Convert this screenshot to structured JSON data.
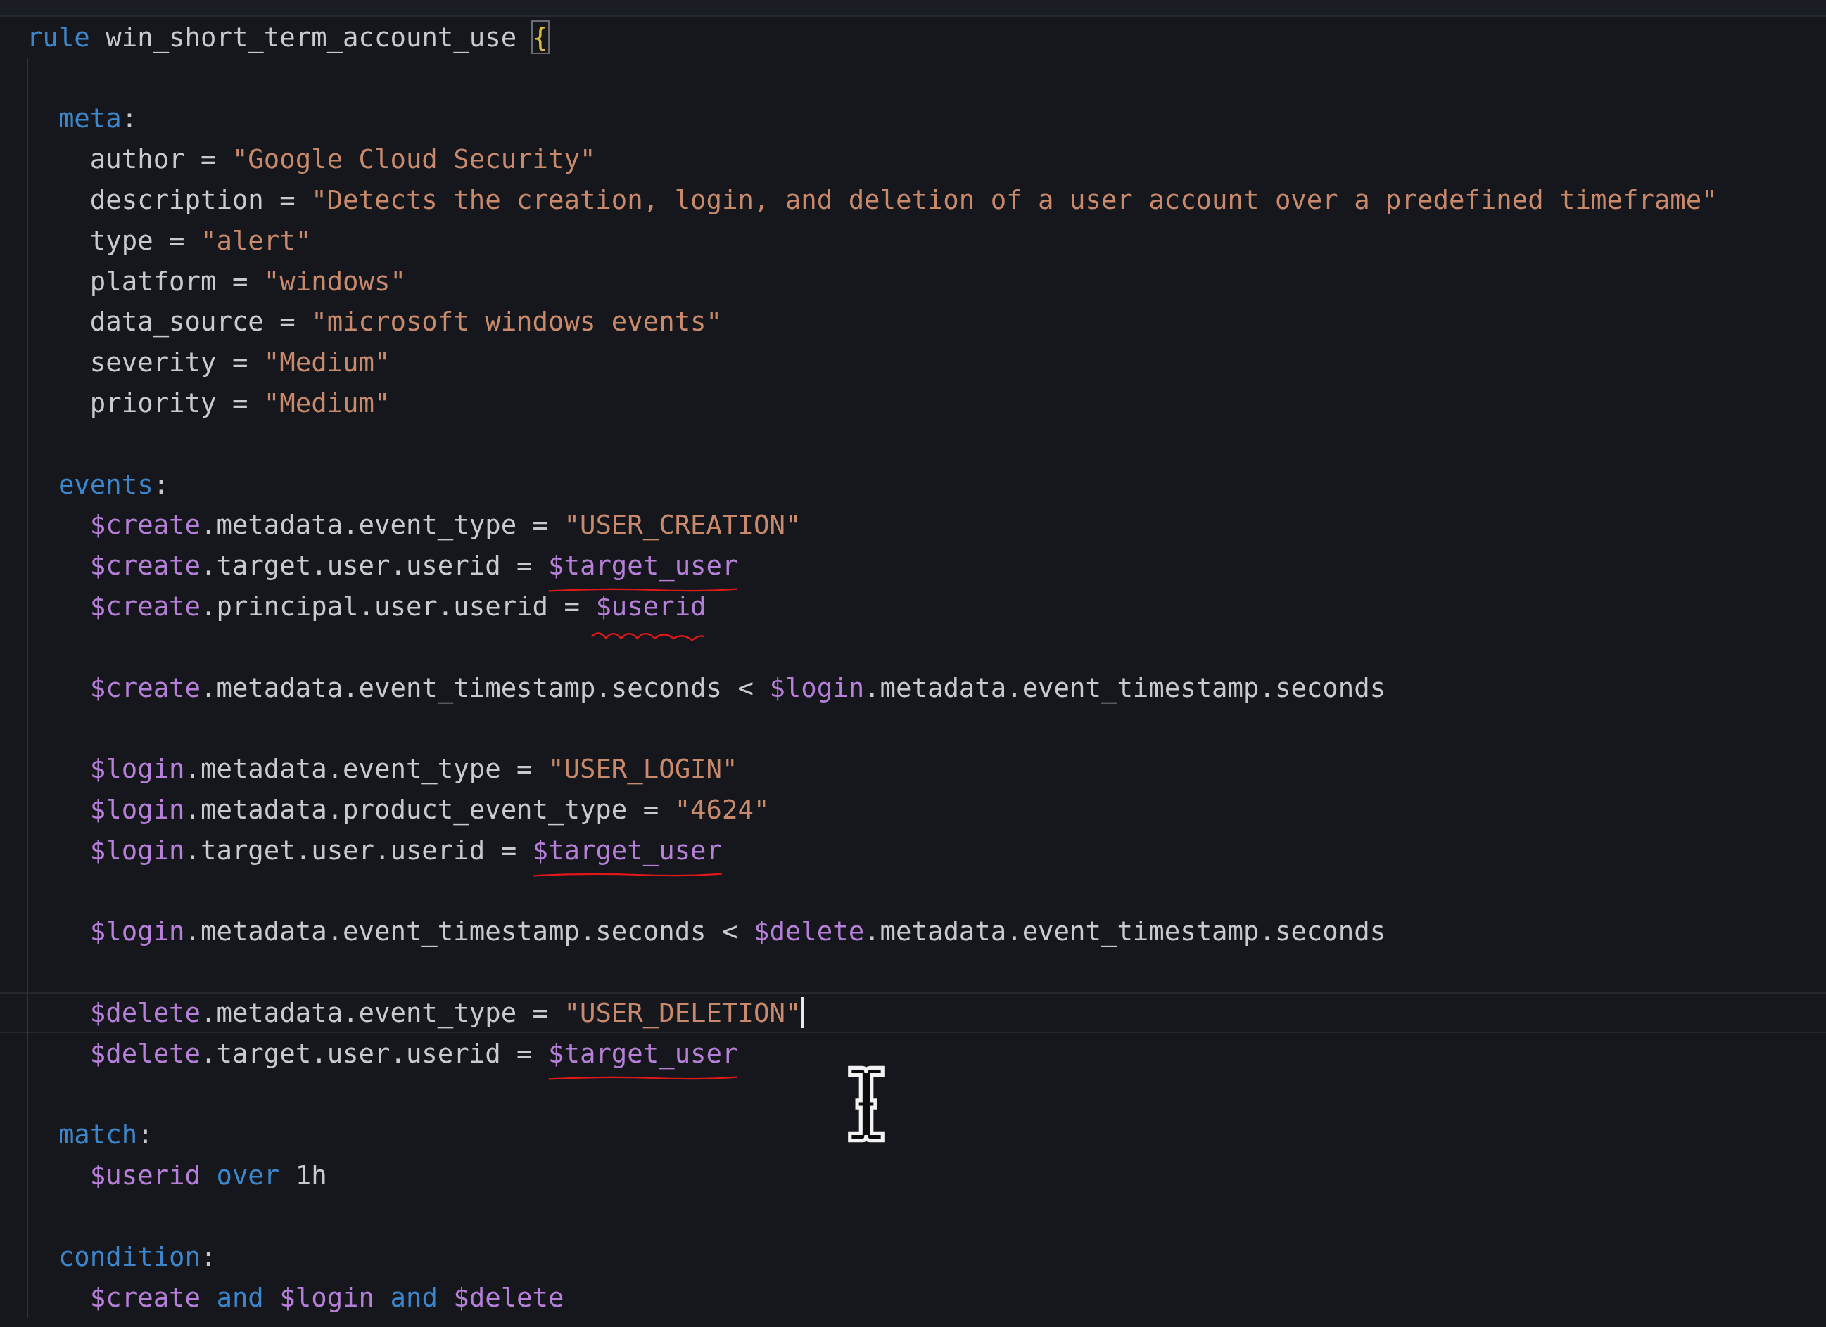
{
  "editor": {
    "rule": {
      "current": false,
      "tokens": [
        {
          "text": "rule",
          "kind": "keyword"
        },
        {
          "text": " win_short_term_account_use ",
          "kind": "plain"
        },
        {
          "text": "{",
          "kind": "bracket-match"
        }
      ],
      "children": [
        {
          "kind": "blank",
          "current": false
        },
        {
          "kind": "section",
          "current": false,
          "tokens": [
            {
              "text": "meta",
              "kind": "keyword"
            },
            {
              "text": ":",
              "kind": "plain"
            }
          ],
          "children": [
            {
              "kind": "code",
              "current": false,
              "tokens": [
                {
                  "text": "author = ",
                  "kind": "plain"
                },
                {
                  "text": "\"Google Cloud Security\"",
                  "kind": "string"
                }
              ]
            },
            {
              "kind": "code",
              "current": false,
              "tokens": [
                {
                  "text": "description = ",
                  "kind": "plain"
                },
                {
                  "text": "\"Detects the creation, login, and deletion of a user account over a predefined timeframe\"",
                  "kind": "string"
                }
              ]
            },
            {
              "kind": "code",
              "current": false,
              "tokens": [
                {
                  "text": "type = ",
                  "kind": "plain"
                },
                {
                  "text": "\"alert\"",
                  "kind": "string"
                }
              ]
            },
            {
              "kind": "code",
              "current": false,
              "tokens": [
                {
                  "text": "platform = ",
                  "kind": "plain"
                },
                {
                  "text": "\"windows\"",
                  "kind": "string"
                }
              ]
            },
            {
              "kind": "code",
              "current": false,
              "tokens": [
                {
                  "text": "data_source = ",
                  "kind": "plain"
                },
                {
                  "text": "\"microsoft windows events\"",
                  "kind": "string"
                }
              ]
            },
            {
              "kind": "code",
              "current": false,
              "tokens": [
                {
                  "text": "severity = ",
                  "kind": "plain"
                },
                {
                  "text": "\"Medium\"",
                  "kind": "string"
                }
              ]
            },
            {
              "kind": "code",
              "current": false,
              "tokens": [
                {
                  "text": "priority = ",
                  "kind": "plain"
                },
                {
                  "text": "\"Medium\"",
                  "kind": "string"
                }
              ]
            }
          ]
        },
        {
          "kind": "blank",
          "current": false
        },
        {
          "kind": "section",
          "current": false,
          "tokens": [
            {
              "text": "events",
              "kind": "keyword"
            },
            {
              "text": ":",
              "kind": "plain"
            }
          ],
          "children": [
            {
              "kind": "code",
              "current": false,
              "tokens": [
                {
                  "text": "$create",
                  "kind": "variable"
                },
                {
                  "text": ".metadata.event_type = ",
                  "kind": "plain"
                },
                {
                  "text": "\"USER_CREATION\"",
                  "kind": "string"
                }
              ]
            },
            {
              "kind": "code",
              "current": false,
              "tokens": [
                {
                  "text": "$create",
                  "kind": "variable"
                },
                {
                  "text": ".target.user.userid = ",
                  "kind": "plain"
                },
                {
                  "text": "$target_user",
                  "kind": "variable",
                  "annotation": {
                    "kind": "underline"
                  }
                }
              ]
            },
            {
              "kind": "code",
              "current": false,
              "tokens": [
                {
                  "text": "$create",
                  "kind": "variable"
                },
                {
                  "text": ".principal.user.userid = ",
                  "kind": "plain"
                },
                {
                  "text": "$userid",
                  "kind": "variable",
                  "annotation": {
                    "kind": "squiggle"
                  }
                }
              ]
            },
            {
              "kind": "blank",
              "current": false
            },
            {
              "kind": "code",
              "current": false,
              "tokens": [
                {
                  "text": "$create",
                  "kind": "variable"
                },
                {
                  "text": ".metadata.event_timestamp.seconds < ",
                  "kind": "plain"
                },
                {
                  "text": "$login",
                  "kind": "variable"
                },
                {
                  "text": ".metadata.event_timestamp.seconds",
                  "kind": "plain"
                }
              ]
            },
            {
              "kind": "blank",
              "current": false
            },
            {
              "kind": "code",
              "current": false,
              "tokens": [
                {
                  "text": "$login",
                  "kind": "variable"
                },
                {
                  "text": ".metadata.event_type = ",
                  "kind": "plain"
                },
                {
                  "text": "\"USER_LOGIN\"",
                  "kind": "string"
                }
              ]
            },
            {
              "kind": "code",
              "current": false,
              "tokens": [
                {
                  "text": "$login",
                  "kind": "variable"
                },
                {
                  "text": ".metadata.product_event_type = ",
                  "kind": "plain"
                },
                {
                  "text": "\"4624\"",
                  "kind": "string"
                }
              ]
            },
            {
              "kind": "code",
              "current": false,
              "tokens": [
                {
                  "text": "$login",
                  "kind": "variable"
                },
                {
                  "text": ".target.user.userid = ",
                  "kind": "plain"
                },
                {
                  "text": "$target_user",
                  "kind": "variable",
                  "annotation": {
                    "kind": "underline"
                  }
                }
              ]
            },
            {
              "kind": "blank",
              "current": false
            },
            {
              "kind": "code",
              "current": false,
              "tokens": [
                {
                  "text": "$login",
                  "kind": "variable"
                },
                {
                  "text": ".metadata.event_timestamp.seconds < ",
                  "kind": "plain"
                },
                {
                  "text": "$delete",
                  "kind": "variable"
                },
                {
                  "text": ".metadata.event_timestamp.seconds",
                  "kind": "plain"
                }
              ]
            },
            {
              "kind": "blank",
              "current": false
            },
            {
              "kind": "code",
              "current": true,
              "tokens": [
                {
                  "text": "$delete",
                  "kind": "variable"
                },
                {
                  "text": ".metadata.event_type = ",
                  "kind": "plain"
                },
                {
                  "text": "\"USER_DELETION\"",
                  "kind": "string"
                }
              ]
            },
            {
              "kind": "code",
              "current": false,
              "tokens": [
                {
                  "text": "$delete",
                  "kind": "variable"
                },
                {
                  "text": ".target.user.userid = ",
                  "kind": "plain"
                },
                {
                  "text": "$target_user",
                  "kind": "variable",
                  "annotation": {
                    "kind": "underline"
                  }
                }
              ]
            }
          ]
        },
        {
          "kind": "blank",
          "current": false
        },
        {
          "kind": "section",
          "current": false,
          "tokens": [
            {
              "text": "match",
              "kind": "keyword"
            },
            {
              "text": ":",
              "kind": "plain"
            }
          ],
          "children": [
            {
              "kind": "code",
              "current": false,
              "tokens": [
                {
                  "text": "$userid",
                  "kind": "variable"
                },
                {
                  "text": " over ",
                  "kind": "keyword"
                },
                {
                  "text": "1h",
                  "kind": "plain"
                }
              ]
            }
          ]
        },
        {
          "kind": "blank",
          "current": false
        },
        {
          "kind": "section",
          "current": false,
          "tokens": [
            {
              "text": "condition",
              "kind": "keyword"
            },
            {
              "text": ":",
              "kind": "plain"
            }
          ],
          "children": [
            {
              "kind": "code",
              "current": false,
              "tokens": [
                {
                  "text": "$create",
                  "kind": "variable"
                },
                {
                  "text": " and ",
                  "kind": "keyword"
                },
                {
                  "text": "$login",
                  "kind": "variable"
                },
                {
                  "text": " and ",
                  "kind": "keyword"
                },
                {
                  "text": "$delete",
                  "kind": "variable"
                }
              ]
            }
          ]
        }
      ]
    }
  }
}
